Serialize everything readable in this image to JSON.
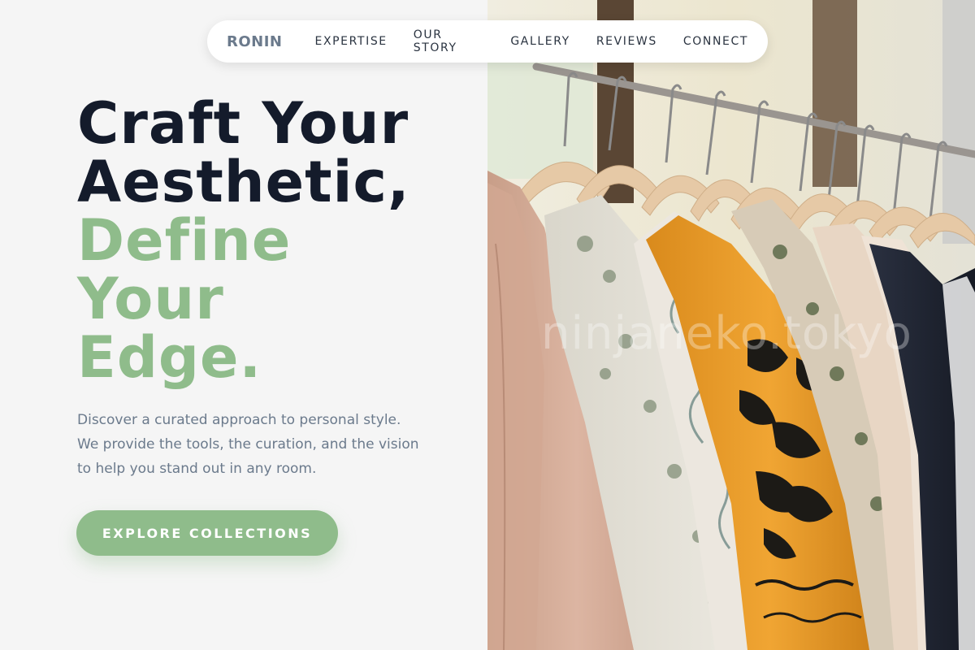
{
  "nav": {
    "brand": "RONIN",
    "links": [
      "EXPERTISE",
      "OUR STORY",
      "GALLERY",
      "REVIEWS",
      "CONNECT"
    ]
  },
  "hero": {
    "headline_dark": [
      "Craft Your",
      "Aesthetic,"
    ],
    "headline_green": [
      "Define",
      "Your",
      "Edge."
    ],
    "subtext": "Discover a curated approach to personal style. We provide the tools, the curation, and the vision to help you stand out in any room.",
    "cta_label": "EXPLORE COLLECTIONS"
  },
  "image": {
    "subject": "clothing-rack-photo",
    "watermark": "ninjaneko.tokyo"
  },
  "colors": {
    "accent": "#8fbc8b",
    "heading": "#141b2b",
    "body_text": "#6b7a8c",
    "background": "#f5f5f5"
  }
}
